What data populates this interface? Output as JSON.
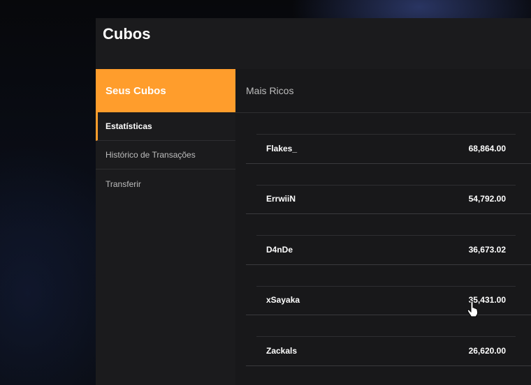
{
  "panel": {
    "title": "Cubos"
  },
  "sidebar": {
    "header": "Seus Cubos",
    "items": [
      {
        "label": "Estatísticas",
        "active": true
      },
      {
        "label": "Histórico de Transações",
        "active": false
      },
      {
        "label": "Transferir",
        "active": false
      }
    ]
  },
  "content": {
    "header": "Mais Ricos",
    "rows": [
      {
        "name": "Flakes_",
        "value": "68,864.00"
      },
      {
        "name": "ErrwiiN",
        "value": "54,792.00"
      },
      {
        "name": "D4nDe",
        "value": "36,673.02"
      },
      {
        "name": "xSayaka",
        "value": "35,431.00"
      },
      {
        "name": "Zackals",
        "value": "26,620.00"
      }
    ]
  },
  "colors": {
    "accent": "#ff9d2c",
    "panel": "#1b1b1d",
    "text": "#ffffff"
  },
  "icons": {
    "cursor": "hand-pointer-icon"
  }
}
